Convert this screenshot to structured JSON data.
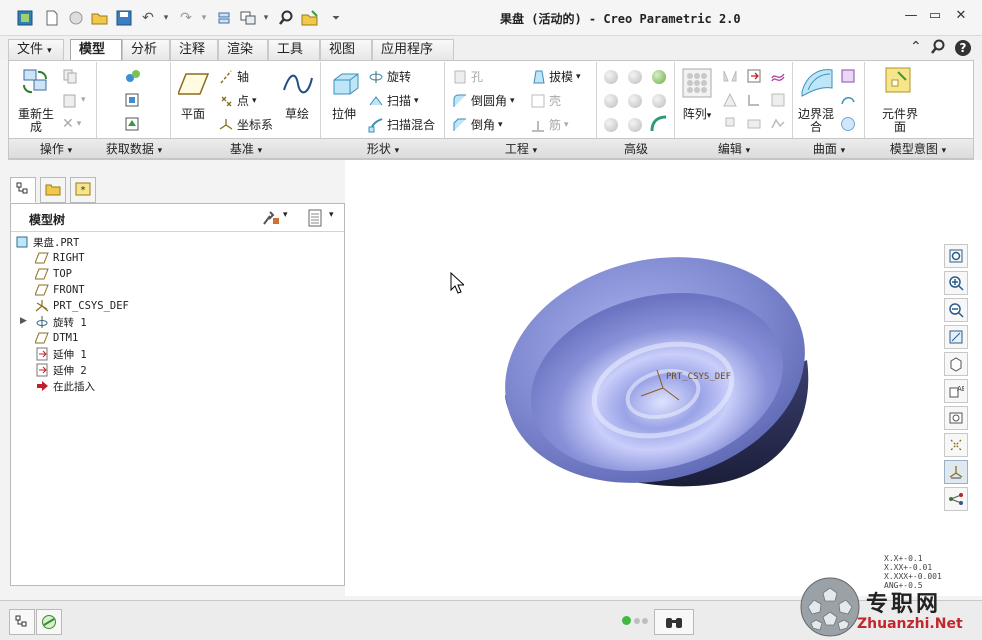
{
  "window": {
    "title": "果盘 (活动的) - Creo Parametric 2.0",
    "minimize": "—",
    "maximize": "▭",
    "close": "✕"
  },
  "tabs": [
    {
      "label": "文件"
    },
    {
      "label": "模型"
    },
    {
      "label": "分析"
    },
    {
      "label": "注释"
    },
    {
      "label": "渲染"
    },
    {
      "label": "工具"
    },
    {
      "label": "视图"
    },
    {
      "label": "应用程序"
    }
  ],
  "ribbon": {
    "operations": {
      "regenerate": "重新生成",
      "group_label": "操作"
    },
    "get_data": {
      "group_label": "获取数据"
    },
    "datum": {
      "plane": "平面",
      "axis": "轴",
      "point": "点",
      "csys": "坐标系",
      "sketch": "草绘",
      "group_label": "基准"
    },
    "shapes": {
      "extrude": "拉伸",
      "revolve": "旋转",
      "sweep": "扫描",
      "swept_blend": "扫描混合",
      "group_label": "形状"
    },
    "engineering": {
      "hole": "孔",
      "round": "倒圆角",
      "chamfer": "倒角",
      "draft": "拔模",
      "shell": "壳",
      "rib": "筋",
      "group_label": "工程"
    },
    "advanced": {
      "group_label": "高级"
    },
    "editing": {
      "pattern": "阵列",
      "group_label": "编辑"
    },
    "surfaces": {
      "boundary_blend": "边界混合",
      "group_label": "曲面"
    },
    "model_intent": {
      "component_interface": "元件界面",
      "group_label": "模型意图"
    }
  },
  "model_tree": {
    "title": "模型树",
    "items": [
      {
        "label": "果盘.PRT",
        "icon": "part-icon"
      },
      {
        "label": "RIGHT",
        "icon": "datum-plane-icon"
      },
      {
        "label": "TOP",
        "icon": "datum-plane-icon"
      },
      {
        "label": "FRONT",
        "icon": "datum-plane-icon"
      },
      {
        "label": "PRT_CSYS_DEF",
        "icon": "csys-icon"
      },
      {
        "label": "旋转 1",
        "icon": "revolve-icon"
      },
      {
        "label": "DTM1",
        "icon": "datum-plane-icon"
      },
      {
        "label": "延伸 1",
        "icon": "extend-icon"
      },
      {
        "label": "延伸 2",
        "icon": "extend-icon"
      },
      {
        "label": "在此插入",
        "icon": "insert-here-icon"
      }
    ]
  },
  "viewport": {
    "csys_label": "PRT_CSYS_DEF",
    "tolerance": [
      "X.X+-0.1",
      "X.XX+-0.01",
      "X.XXX+-0.001",
      "ANG+-0.5"
    ]
  },
  "watermark": {
    "text": "专职网",
    "url": "Zhuanzhi.Net"
  },
  "colors": {
    "part_body": "#8a93d6",
    "part_dark": "#20243f",
    "accent_green": "#3dbb3d"
  }
}
